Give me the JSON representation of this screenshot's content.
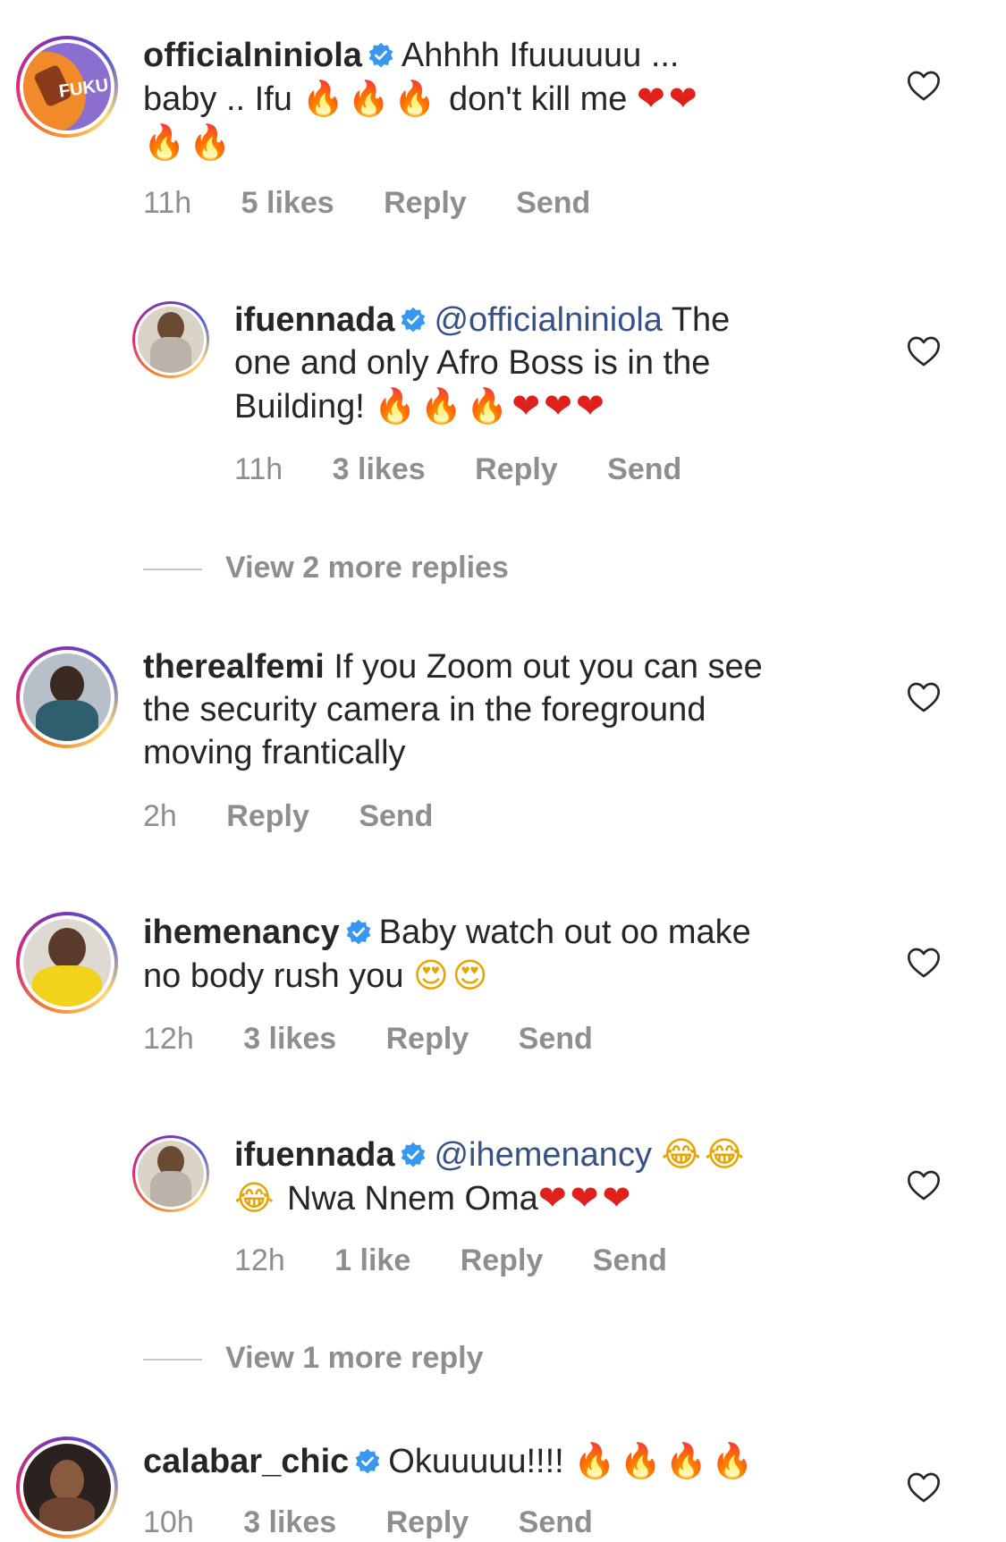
{
  "comments": [
    {
      "username": "officialniniola",
      "verified": true,
      "text_line1": "Ahhhh Ifuuuuuu ...",
      "text_line2_prefix": "baby .. Ifu",
      "emoji_fire_3": "🔥🔥🔥",
      "text_line2_mid": "don't kill me",
      "emoji_heart_2": "❤❤",
      "emoji_fire_2": "🔥🔥",
      "time": "11h",
      "likes": "5 likes",
      "reply": "Reply",
      "send": "Send",
      "avatar_text": "FUKU"
    },
    {
      "username": "ifuennada",
      "verified": true,
      "mention": "@officialniniola",
      "text_line1": "The",
      "text_line2": "one and only Afro Boss is in the",
      "text_line3": "Building!",
      "emoji": "🔥🔥🔥❤❤❤",
      "time": "11h",
      "likes": "3 likes",
      "reply": "Reply",
      "send": "Send"
    },
    {
      "view_more": "View 2 more replies"
    },
    {
      "username": "therealfemi",
      "verified": false,
      "text_line1": "If you Zoom out you can see",
      "text_line2": "the security camera in the foreground",
      "text_line3": "moving frantically",
      "time": "2h",
      "reply": "Reply",
      "send": "Send"
    },
    {
      "username": "ihemenancy",
      "verified": true,
      "text_line1": "Baby watch out oo make",
      "text_line2": "no body rush you",
      "emoji": "😍😍",
      "time": "12h",
      "likes": "3 likes",
      "reply": "Reply",
      "send": "Send"
    },
    {
      "username": "ifuennada",
      "verified": true,
      "mention": "@ihemenancy",
      "emoji_line1": "😂😂",
      "emoji_line2": "😂",
      "text_line2": "Nwa Nnem Oma",
      "emoji_hearts": "❤❤❤",
      "time": "12h",
      "likes": "1 like",
      "reply": "Reply",
      "send": "Send"
    },
    {
      "view_more": "View 1 more reply"
    },
    {
      "username": "calabar_chic",
      "verified": true,
      "text_line1": "Okuuuuu!!!!",
      "emoji": "🔥🔥🔥🔥",
      "time": "10h",
      "likes": "3 likes",
      "reply": "Reply",
      "send": "Send"
    }
  ],
  "colors": {
    "text": "#262626",
    "meta": "#8e8e8e",
    "mention": "#385185",
    "verified": "#3897f0",
    "heart_outline": "#262626"
  },
  "icons": {
    "verified": "verified-badge-icon",
    "like": "heart-outline-icon"
  }
}
